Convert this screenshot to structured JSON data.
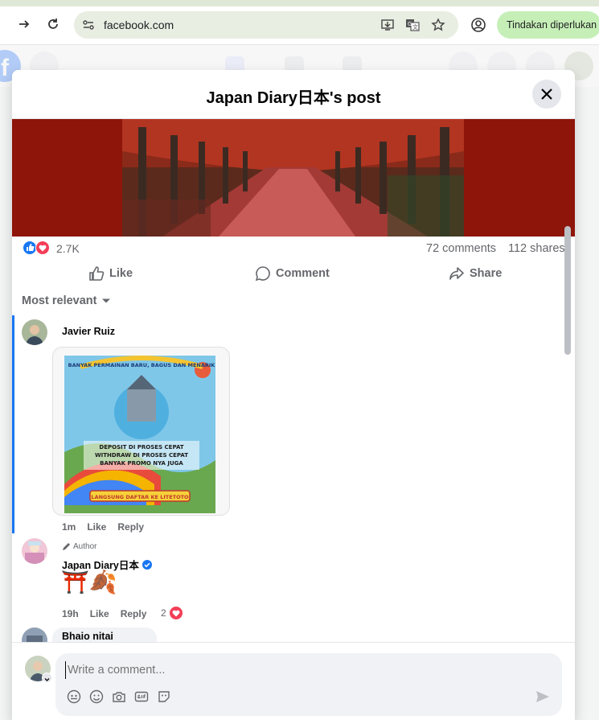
{
  "browser": {
    "url": "facebook.com",
    "action_pill": "Tindakan diperlukan"
  },
  "modal": {
    "title": "Japan Diary日本's post"
  },
  "post": {
    "reaction_count": "2.7K",
    "comments_count": "72 comments",
    "shares_count": "112 shares"
  },
  "actions": {
    "like": "Like",
    "comment": "Comment",
    "share": "Share"
  },
  "sort_label": "Most relevant",
  "comments": [
    {
      "author": "Javier Ruiz",
      "sticker_lines": [
        "BANYAK PERMAINAN BARU, BAGUS DAN MENARIK",
        "DEPOSIT DI PROSES CEPAT",
        "WITHDRAW DI PROSES CEPAT",
        "BANYAK PROMO NYA JUGA",
        "LANGSUNG DAFTAR KE LITETOTO"
      ],
      "time": "1m",
      "like": "Like",
      "reply": "Reply"
    },
    {
      "author_tag": "Author",
      "author": "Japan Diary日本",
      "text": "⛩️🍂",
      "time": "19h",
      "like": "Like",
      "reply": "Reply",
      "reactions": "2"
    },
    {
      "author": "Bhaio nitai"
    }
  ],
  "composer": {
    "placeholder": "Write a comment..."
  },
  "colors": {
    "fb_blue": "#0866ff",
    "image_bg": "#8e150a",
    "pill": "#c6efb8"
  }
}
